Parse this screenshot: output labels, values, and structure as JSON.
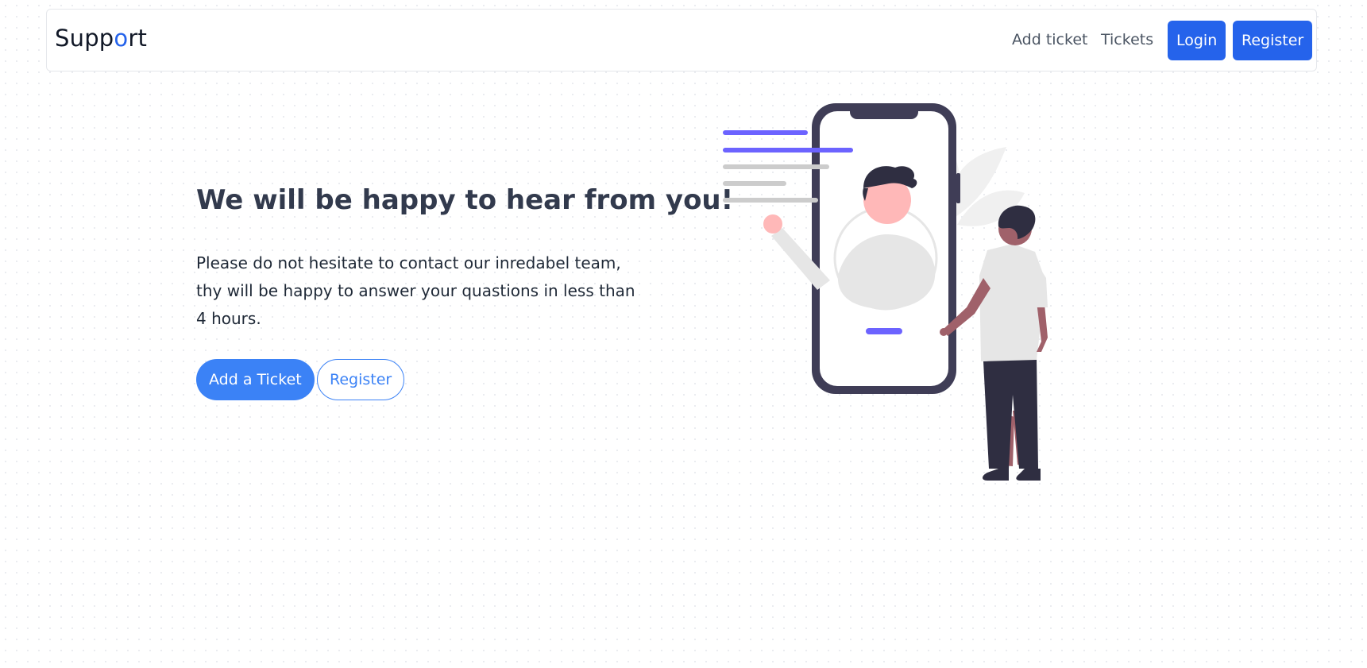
{
  "navbar": {
    "brand": {
      "prefix": "Supp",
      "accent": "o",
      "suffix": "rt"
    },
    "links": {
      "add_ticket": "Add ticket",
      "tickets": "Tickets"
    },
    "buttons": {
      "login": "Login",
      "register": "Register"
    }
  },
  "hero": {
    "title": "We will be happy to hear from you!",
    "text": "Please do not hesitate to contact our inredabel team, thy will be happy to answer your quastions in less than 4 hours.",
    "primary_button": "Add a Ticket",
    "secondary_button": "Register"
  },
  "colors": {
    "brand_accent": "#2563eb",
    "primary_button": "#3b82f6",
    "illustration_accent": "#6c63ff",
    "phone_frame": "#3f3d56",
    "heading": "#323a4d"
  },
  "illustration": {
    "icon": "contact-support-illustration"
  }
}
